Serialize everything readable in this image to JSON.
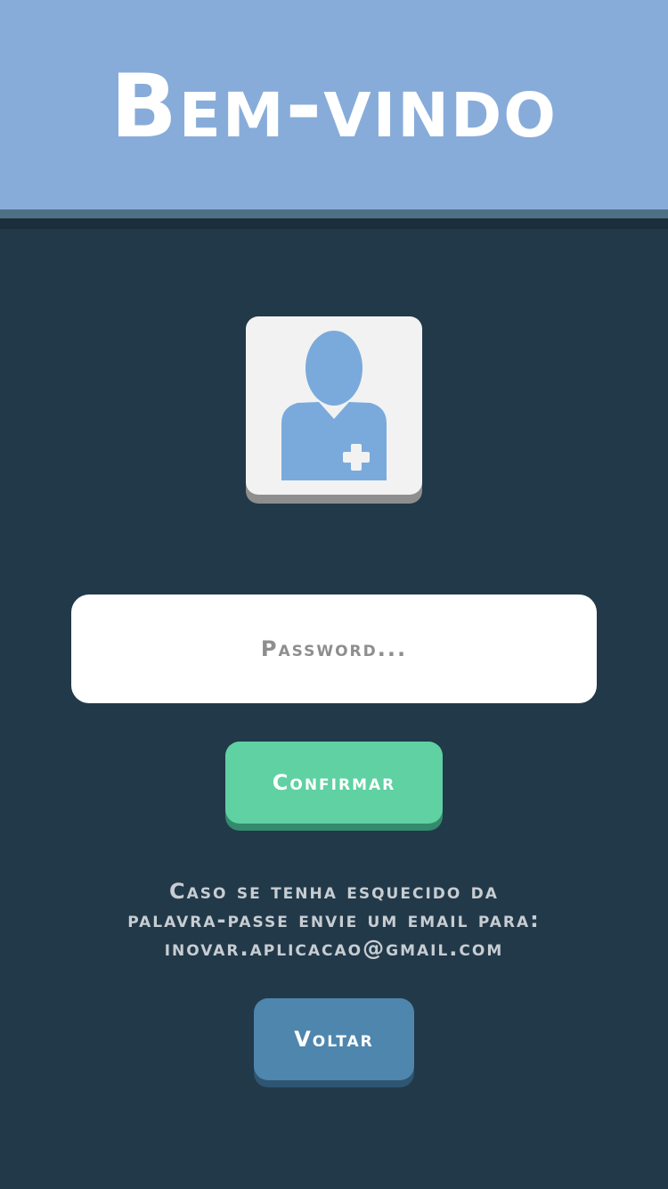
{
  "header": {
    "title": "Bem-vindo"
  },
  "avatar": {
    "icon": "doctor-user-icon"
  },
  "password": {
    "placeholder": "Password...",
    "value": ""
  },
  "buttons": {
    "confirm_label": "Confirmar",
    "back_label": "Voltar"
  },
  "info": {
    "line1": "Caso se tenha esquecido da",
    "line2": "palavra-passe envie um email para:",
    "line3": "inovar.aplicacao@gmail.com"
  },
  "colors": {
    "background": "#223949",
    "header": "#87acd9",
    "confirm": "#5fd1a2",
    "back": "#4e86ad",
    "icon": "#7aaadb"
  }
}
